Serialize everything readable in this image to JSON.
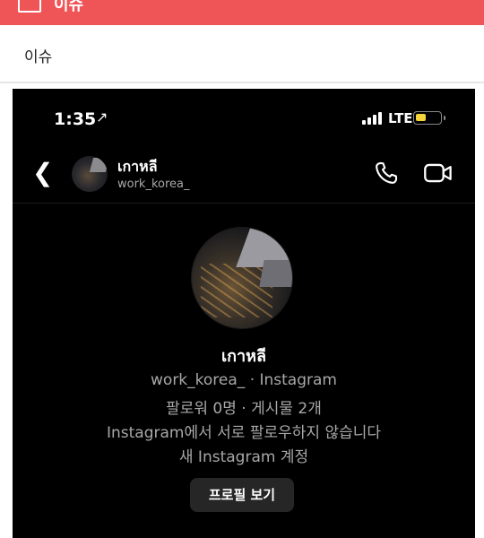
{
  "header": {
    "title": "이슈",
    "category_label": "이슈"
  },
  "phone": {
    "status": {
      "time": "1:35",
      "location_glyph": "↗",
      "network": "LTE",
      "battery_color": "#f5d33b"
    },
    "chat_header": {
      "name": "เกาหลี",
      "handle": "work_korea_"
    },
    "profile": {
      "name": "เกาหลี",
      "subtitle": "work_korea_ · Instagram",
      "stats": "팔로워 0명 · 게시물 2개",
      "follow_status": "Instagram에서 서로 팔로우하지 않습니다",
      "account_note": "새 Instagram 계정",
      "view_profile_button": "프로필 보기"
    }
  },
  "colors": {
    "topbar": "#ef5557",
    "phone_bg": "#000000",
    "button_bg": "#262626",
    "secondary_text": "#a8a8a8"
  },
  "icons": [
    "back-chevron-icon",
    "phone-icon",
    "video-camera-icon",
    "location-arrow-icon",
    "signal-icon",
    "battery-icon"
  ]
}
